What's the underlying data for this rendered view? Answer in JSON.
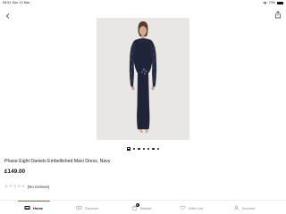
{
  "status_bar": {
    "time": "08:51",
    "date": "Sun 13 Mar",
    "battery": "73%"
  },
  "nav": {
    "back_icon": "chevron-left-icon",
    "share_icon": "share-icon"
  },
  "gallery": {
    "page_count": 7,
    "active_index": 0
  },
  "product": {
    "title": "Phase Eight Daniels Embellished Maxi Dress, Navy",
    "price": "£149.00",
    "rating_stars": 0,
    "reviews_label": "(No reviews)"
  },
  "tab_bar": {
    "items": [
      {
        "label": "Home",
        "icon": "home-icon",
        "active": true
      },
      {
        "label": "Discover",
        "icon": "discover-icon",
        "active": false
      },
      {
        "label": "Basket",
        "icon": "basket-icon",
        "active": false,
        "badge": "0"
      },
      {
        "label": "Wish List",
        "icon": "heart-icon",
        "active": false
      },
      {
        "label": "Account",
        "icon": "account-icon",
        "active": false
      }
    ]
  },
  "colors": {
    "accent": "#1e9c52",
    "dress": "#1f2438",
    "image_background": "#e8e7e5"
  }
}
